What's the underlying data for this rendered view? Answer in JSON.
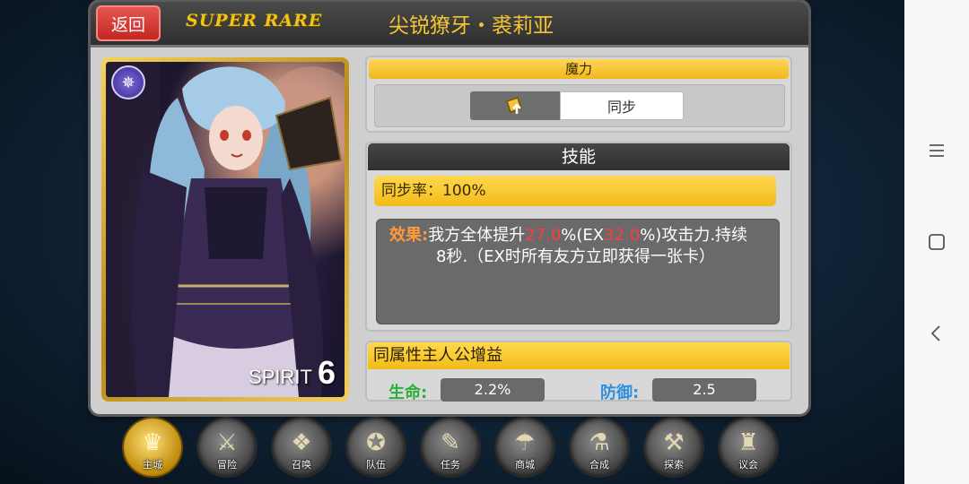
{
  "header": {
    "back_label": "返回",
    "rarity": "SUPER RARE",
    "title": "尖锐獠牙・裘莉亚"
  },
  "card": {
    "element_icon": "spirit-element-icon",
    "spirit_label": "SPIRIT",
    "spirit_value": "6"
  },
  "mana": {
    "header": "魔力",
    "icon": "card-up-icon",
    "sync_label": "同步"
  },
  "skill": {
    "header": "技能",
    "sync_rate_label": "同步率：",
    "sync_rate_value": "100%",
    "effect_label": "效果:",
    "effect_text_1": "我方全体提升",
    "effect_value_1": "27.0",
    "effect_text_2": "%(EX",
    "effect_value_2": "32.0",
    "effect_text_3": "%)攻击力.持续",
    "effect_line_2": "8秒.（EX时所有友方立即获得一张卡）"
  },
  "bonus": {
    "header": "同属性主人公增益",
    "hp_label": "生命:",
    "hp_value": "2.2%",
    "def_label": "防御:",
    "def_value": "2.5"
  },
  "bottom_menu": [
    {
      "label": "主城",
      "icon": "castle-icon",
      "glyph": "♛"
    },
    {
      "label": "冒险",
      "icon": "crossed-swords-icon",
      "glyph": "⚔"
    },
    {
      "label": "召唤",
      "icon": "summon-cards-icon",
      "glyph": "❖"
    },
    {
      "label": "队伍",
      "icon": "team-emblem-icon",
      "glyph": "✪"
    },
    {
      "label": "任务",
      "icon": "quest-book-icon",
      "glyph": "✎"
    },
    {
      "label": "商城",
      "icon": "shop-icon",
      "glyph": "☂"
    },
    {
      "label": "合成",
      "icon": "synthesis-icon",
      "glyph": "⚗"
    },
    {
      "label": "探索",
      "icon": "explore-icon",
      "glyph": "⚒"
    },
    {
      "label": "议会",
      "icon": "council-icon",
      "glyph": "♜"
    }
  ],
  "system_nav": {
    "menu_icon": "menu-icon",
    "home_icon": "home-icon",
    "back_icon": "back-icon"
  },
  "colors": {
    "accent_gold": "#f2bb19",
    "back_button_red": "#d8322c",
    "effect_highlight_red": "#ff3c3c"
  }
}
